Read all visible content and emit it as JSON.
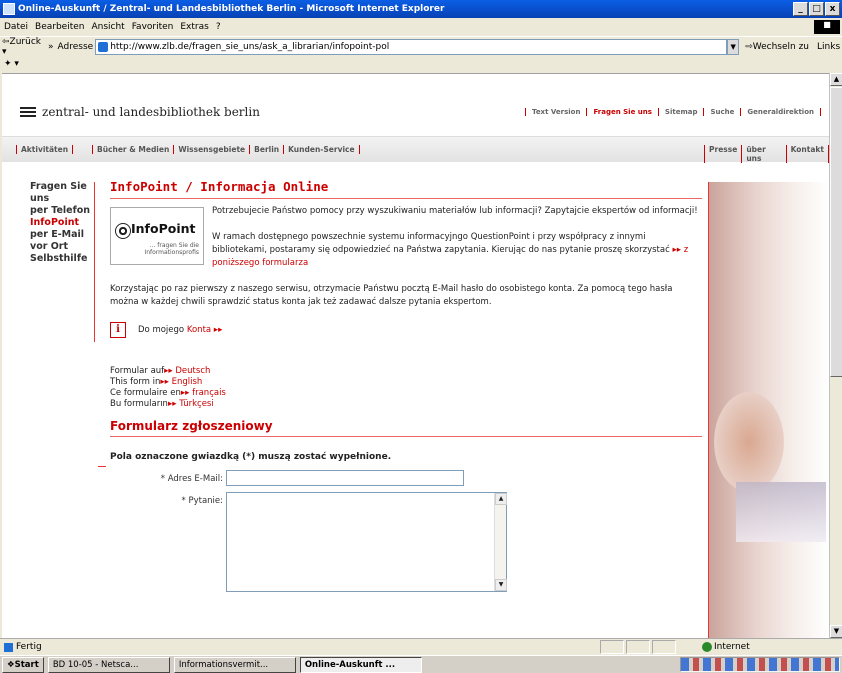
{
  "window": {
    "title": "Online-Auskunft / Zentral- und Landesbibliothek Berlin - Microsoft Internet Explorer",
    "controls": [
      "_",
      "□",
      "x"
    ]
  },
  "menubar": [
    "Datei",
    "Bearbeiten",
    "Ansicht",
    "Favoriten",
    "Extras",
    "?"
  ],
  "toolbar": {
    "back_label": "⇦Zurück ▾",
    "addr_label": "Adresse",
    "url": "http://www.zlb.de/fragen_sie_uns/ask_a_librarian/infopoint-pol",
    "go_label": "Wechseln zu",
    "links_label": "Links"
  },
  "site": {
    "logo_text": "zentral- und landesbibliothek berlin",
    "topnav": [
      "Text Version",
      "Fragen Sie uns",
      "Sitemap",
      "Suche",
      "Generaldirektion"
    ],
    "topnav_active": "Fragen Sie uns",
    "sitenav_left": [
      "Aktivitäten"
    ],
    "sitenav_mid": [
      "Bücher & Medien",
      "Wissensgebiete",
      "Berlin",
      "Kunden-Service"
    ],
    "sitenav_right": [
      "Presse",
      "über uns",
      "Kontakt"
    ],
    "leftnav": [
      "Fragen Sie uns",
      "per Telefon",
      "InfoPoint",
      "per E-Mail",
      "vor Ort",
      "Selbsthilfe"
    ],
    "leftnav_active": "InfoPoint"
  },
  "content": {
    "heading": "InfoPoint / Informacja Online",
    "infopoint_logo": {
      "name": "InfoPoint",
      "sub": "... fragen Sie die Informationsprofis"
    },
    "p1": "Potrzebujecie Państwo pomocy przy wyszukiwaniu materiałów lub informacji? Zapytajcie ekspertów od informacji!",
    "p2_text": "W ramach dostępnego powszechnie systemu informacyjngo QuestionPoint i przy współpracy z innymi bibliotekami, postaramy się odpowiedzieć na Państwa zapytania. Kierując do nas pytanie proszę skorzystać",
    "p2_link": "▸▸ z poniższego formularza",
    "p3": "Korzystając po raz pierwszy z naszego serwisu, otrzymacie Państwu pocztą E-Mail hasło do osobistego konta. Za pomocą tego hasła można w każdej chwili sprawdzić status konta jak też zadawać dalsze pytania ekspertom.",
    "info_icon": "i",
    "account_text": "Do mojego",
    "account_link": "Konta ▸▸",
    "languages": [
      {
        "text": "Formular auf",
        "link": "▸▸ Deutsch"
      },
      {
        "text": "This form in",
        "link": "▸▸ English"
      },
      {
        "text": "Ce formulaire en",
        "link": "▸▸ français"
      },
      {
        "text": "Bu formuların",
        "link": "▸▸ Türkçesi"
      }
    ],
    "form_heading": "Formularz zgłoszeniowy",
    "required_note": "Pola oznaczone gwiazdką (*) muszą zostać wypełnione.",
    "email_label": "* Adres E-Mail:",
    "email_value": "",
    "question_label": "* Pytanie:",
    "question_value": ""
  },
  "statusbar": {
    "left": "Fertig",
    "zone": "Internet"
  },
  "taskbar": {
    "start": "Start",
    "tasks": [
      "BD 10-05 - Netsca...",
      "Informationsvermit...",
      "Online-Auskunft ..."
    ],
    "active_task": 2
  }
}
